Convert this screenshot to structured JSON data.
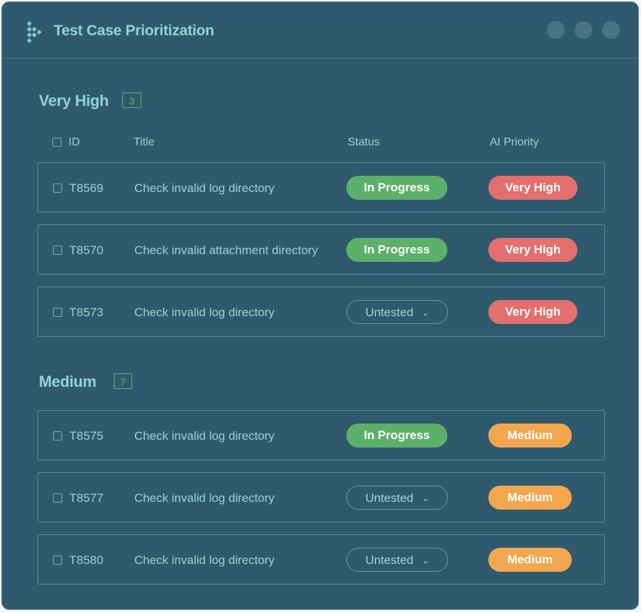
{
  "app": {
    "title": "Test Case Prioritization",
    "logo_icon": "chevron-dots-logo-icon"
  },
  "window_controls": [
    "window-dot",
    "window-dot",
    "window-dot"
  ],
  "columns": {
    "id": "ID",
    "title": "Title",
    "status": "Status",
    "priority": "AI Priority"
  },
  "sections": [
    {
      "name": "Very High",
      "count": "3",
      "rows": [
        {
          "id": "T8569",
          "title": "Check invalid log directory",
          "status": "In Progress",
          "priority": "Very High"
        },
        {
          "id": "T8570",
          "title": "Check invalid attachment directory",
          "status": "In Progress",
          "priority": "Very High"
        },
        {
          "id": "T8573",
          "title": "Check invalid log directory",
          "status": "Untested",
          "priority": "Very High"
        }
      ]
    },
    {
      "name": "Medium",
      "count": "7",
      "rows": [
        {
          "id": "T8575",
          "title": "Check invalid log directory",
          "status": "In Progress",
          "priority": "Medium"
        },
        {
          "id": "T8577",
          "title": "Check invalid log directory",
          "status": "Untested",
          "priority": "Medium"
        },
        {
          "id": "T8580",
          "title": "Check invalid log directory",
          "status": "Untested",
          "priority": "Medium"
        }
      ]
    }
  ],
  "colors": {
    "background": "#2f5a6d",
    "accent_text": "#90d4d9",
    "in_progress": "#5cb06a",
    "very_high": "#e46f6f",
    "medium": "#f2a74f",
    "count_badge": "#6aae66"
  }
}
